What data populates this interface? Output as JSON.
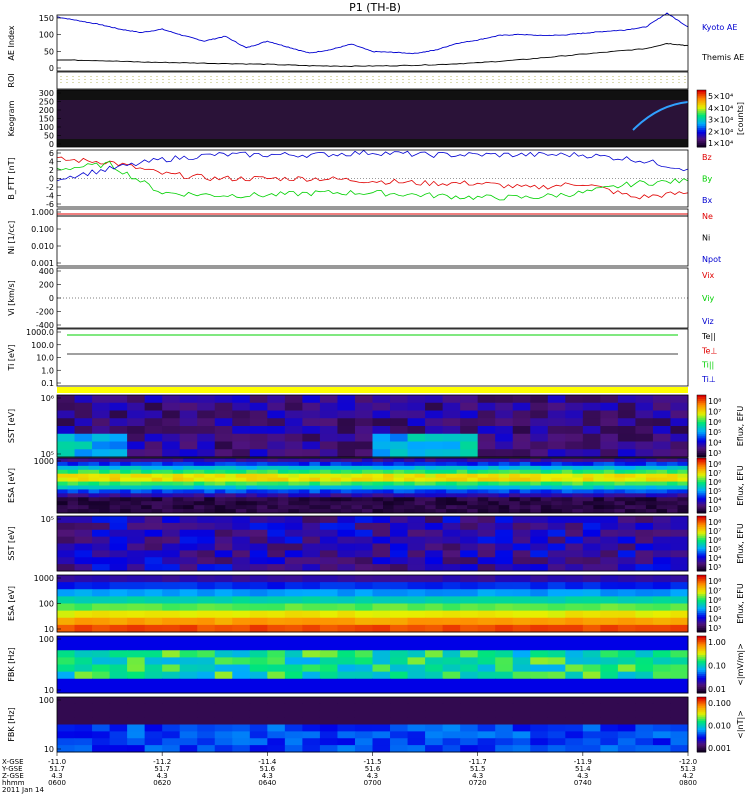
{
  "title": "P1 (TH-B)",
  "colors": {
    "blue": "#0000d0",
    "red": "#e00000",
    "green": "#00d000",
    "black": "#000000",
    "yellow": "#ffff00",
    "purple": "#3a1a55"
  },
  "chart_data": [
    {
      "type": "line",
      "ylabel": "AE Index",
      "ylim": [
        0,
        150
      ],
      "yticks": [
        "150",
        "100",
        "50",
        "0"
      ],
      "series": [
        {
          "name": "Kyoto AE",
          "color": "#0000d0",
          "x": [
            0,
            4,
            8,
            12,
            16,
            20,
            24,
            28,
            32,
            36,
            40,
            44,
            48,
            52,
            56,
            60,
            64,
            68,
            72,
            76,
            80,
            84,
            88,
            92,
            96,
            100,
            104,
            108,
            112,
            116,
            120
          ],
          "values": [
            145,
            135,
            125,
            112,
            103,
            112,
            95,
            80,
            93,
            62,
            80,
            64,
            48,
            57,
            72,
            52,
            50,
            47,
            56,
            74,
            83,
            95,
            98,
            95,
            96,
            101,
            106,
            110,
            118,
            155,
            118
          ]
        },
        {
          "name": "Themis AE",
          "color": "#000000",
          "x": [
            0,
            8,
            16,
            24,
            32,
            40,
            48,
            56,
            64,
            72,
            80,
            88,
            96,
            104,
            112,
            116,
            120
          ],
          "values": [
            30,
            28,
            24,
            22,
            20,
            18,
            14,
            13,
            14,
            17,
            22,
            30,
            40,
            50,
            60,
            74,
            68
          ]
        }
      ]
    },
    {
      "type": "line",
      "ylabel": "ROI",
      "series": []
    },
    {
      "type": "heatmap",
      "ylabel": "Keogram",
      "ylim": [
        0,
        300
      ],
      "yticks": [
        "300",
        "250",
        "200",
        "150",
        "100",
        "50",
        "0"
      ],
      "colorbar": {
        "label": "[counts]",
        "ticks": [
          "5×10⁴",
          "4×10⁴",
          "3×10⁴",
          "2×10⁴",
          "1×10⁴"
        ]
      }
    },
    {
      "type": "line",
      "ylabel": "B_FTT [nT]",
      "yticks": [
        "6",
        "4",
        "2",
        "0",
        "-2",
        "-4",
        "-6"
      ],
      "ylim": [
        -6,
        6
      ],
      "series": [
        {
          "name": "Bz",
          "color": "#e00000",
          "x": [
            0,
            10,
            20,
            30,
            40,
            50,
            60,
            70,
            80,
            90,
            100,
            110,
            120
          ],
          "values": [
            4,
            3.5,
            1,
            0,
            0,
            0,
            -0.5,
            -1,
            -1,
            -2,
            -1,
            -4,
            -3
          ]
        },
        {
          "name": "By",
          "color": "#00d000",
          "x": [
            0,
            10,
            20,
            30,
            40,
            50,
            60,
            70,
            80,
            90,
            100,
            110,
            120
          ],
          "values": [
            2,
            3,
            -3,
            -3.5,
            -3.5,
            -3,
            -3,
            -3.5,
            -4,
            -4,
            -3,
            -1,
            -0.5
          ]
        },
        {
          "name": "Bx",
          "color": "#0000d0",
          "x": [
            0,
            10,
            20,
            30,
            40,
            50,
            60,
            70,
            80,
            90,
            100,
            110,
            120
          ],
          "values": [
            0,
            2,
            4,
            5,
            5,
            5,
            5.5,
            5,
            5,
            5,
            5,
            4,
            2
          ]
        }
      ]
    },
    {
      "type": "line",
      "ylabel": "Ni [1/cc]",
      "yticks": [
        "1.000",
        "0.100",
        "0.010",
        "0.001"
      ],
      "series": [
        {
          "name": "Ne",
          "color": "#e00000"
        },
        {
          "name": "Ni",
          "color": "#000000"
        },
        {
          "name": "Npot",
          "color": "#0000d0"
        }
      ]
    },
    {
      "type": "line",
      "ylabel": "Vi [km/s]",
      "ylim": [
        -500,
        500
      ],
      "yticks": [
        "400",
        "200",
        "0",
        "-200",
        "-400"
      ],
      "series": [
        {
          "name": "Vix",
          "color": "#e00000"
        },
        {
          "name": "Viy",
          "color": "#00d000"
        },
        {
          "name": "Viz",
          "color": "#0000d0"
        }
      ]
    },
    {
      "type": "line",
      "ylabel": "Ti [eV]",
      "yticks": [
        "1000.0",
        "100.0",
        "10.0",
        "1.0",
        "0.1"
      ],
      "series": [
        {
          "name": "Te||",
          "color": "#000000"
        },
        {
          "name": "Te⊥",
          "color": "#e00000"
        },
        {
          "name": "Ti||",
          "color": "#00d000"
        },
        {
          "name": "Ti⊥",
          "color": "#0000d0"
        }
      ]
    },
    {
      "type": "heatmap",
      "ylabel": "SST [eV]",
      "yticks": [
        "10⁶",
        "10⁵"
      ],
      "colorbar": {
        "label": "Eflux, EFU",
        "ticks": [
          "10⁸",
          "10⁷",
          "10⁶",
          "10⁵",
          "10⁴",
          "10³"
        ]
      }
    },
    {
      "type": "heatmap",
      "ylabel": "ESA [eV]",
      "yticks": [
        "1000"
      ],
      "colorbar": {
        "label": "Eflux, EFU",
        "ticks": [
          "10⁸",
          "10⁷",
          "10⁶",
          "10⁵",
          "10⁴",
          "10³"
        ]
      }
    },
    {
      "type": "heatmap",
      "ylabel": "SST [eV]",
      "yticks": [
        "10⁵"
      ],
      "colorbar": {
        "label": "Eflux, EFU",
        "ticks": [
          "10⁸",
          "10⁷",
          "10⁶",
          "10⁵",
          "10⁴",
          "10³"
        ]
      }
    },
    {
      "type": "heatmap",
      "ylabel": "ESA [eV]",
      "yticks": [
        "1000",
        "100",
        "10"
      ],
      "colorbar": {
        "label": "Eflux, EFU",
        "ticks": [
          "10⁸",
          "10⁷",
          "10⁶",
          "10⁵",
          "10⁴",
          "10³"
        ]
      }
    },
    {
      "type": "heatmap",
      "ylabel": "FBK [Hz]",
      "yticks": [
        "100",
        "10"
      ],
      "colorbar": {
        "label": "<|mV/m|>",
        "ticks": [
          "1.00",
          "0.10",
          "0.01"
        ]
      }
    },
    {
      "type": "heatmap",
      "ylabel": "FBK [Hz]",
      "yticks": [
        "100",
        "10"
      ],
      "colorbar": {
        "label": "<|nT|>",
        "ticks": [
          "0.100",
          "0.010",
          "0.001"
        ]
      }
    }
  ],
  "xaxis": {
    "row_labels": [
      "X-GSE",
      "Y-GSE",
      "Z-GSE",
      "hhmm",
      "2011 Jan 14"
    ],
    "ticks": [
      {
        "x": "-11.0",
        "y": "51.7",
        "z": "4.3",
        "t": "0600"
      },
      {
        "x": "-11.2",
        "y": "51.7",
        "z": "4.3",
        "t": "0620"
      },
      {
        "x": "-11.4",
        "y": "51.6",
        "z": "4.3",
        "t": "0640"
      },
      {
        "x": "-11.5",
        "y": "51.6",
        "z": "4.3",
        "t": "0700"
      },
      {
        "x": "-11.7",
        "y": "51.5",
        "z": "4.3",
        "t": "0720"
      },
      {
        "x": "-11.9",
        "y": "51.4",
        "z": "4.3",
        "t": "0740"
      },
      {
        "x": "-12.0",
        "y": "51.3",
        "z": "4.2",
        "t": "0800"
      }
    ]
  }
}
